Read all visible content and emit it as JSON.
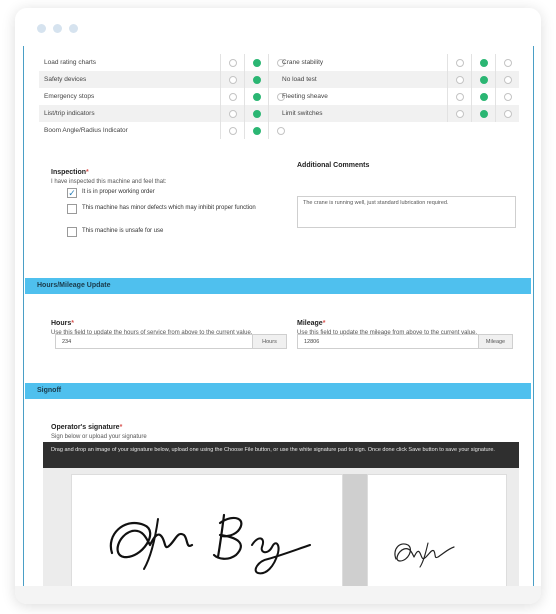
{
  "checklist": {
    "left_rows": [
      {
        "label": "Load rating charts",
        "selected": 1
      },
      {
        "label": "Safety devices",
        "selected": 1
      },
      {
        "label": "Emergency stops",
        "selected": 1
      },
      {
        "label": "List/trip indicators",
        "selected": 1
      },
      {
        "label": "Boom Angle/Radius Indicator",
        "selected": 1
      }
    ],
    "right_rows": [
      {
        "label": "Crane stability",
        "selected": 1
      },
      {
        "label": "No load test",
        "selected": 1
      },
      {
        "label": "Fleeting sheave",
        "selected": 1
      },
      {
        "label": "Limit switches",
        "selected": 1
      }
    ]
  },
  "inspection": {
    "label": "Inspection",
    "required_mark": "*",
    "hint": "I have inspected this machine and feel that:",
    "options": [
      {
        "text": "It is in proper working order",
        "checked": true
      },
      {
        "text": "This machine has minor defects which may inhibit proper function",
        "checked": false
      },
      {
        "text": "This machine is unsafe for use",
        "checked": false
      }
    ]
  },
  "comments": {
    "label": "Additional Comments",
    "value": "The crane is running well, just standard lubrication required."
  },
  "hours_section": {
    "title": "Hours/Mileage Update",
    "hours": {
      "label": "Hours",
      "required_mark": "*",
      "hint": "Use this field to update the hours of service from above to the current value.",
      "value": "234",
      "unit": "Hours"
    },
    "mileage": {
      "label": "Mileage",
      "required_mark": "*",
      "hint": "Use this field to update the mileage from above to the current value.",
      "value": "12806",
      "unit": "Mileage"
    }
  },
  "signoff": {
    "title": "Signoff",
    "signature_label": "Operator's signature",
    "required_mark": "*",
    "hint": "Sign below or upload your signature",
    "instructions": "Drag and drop an image of your signature below, upload one using the Choose File button, or use the white signature pad to sign. Once done click Save button to save your signature."
  },
  "colors": {
    "accent": "#4fc0ee",
    "radio_on": "#2bb673",
    "rail": "#4a9fc6"
  }
}
